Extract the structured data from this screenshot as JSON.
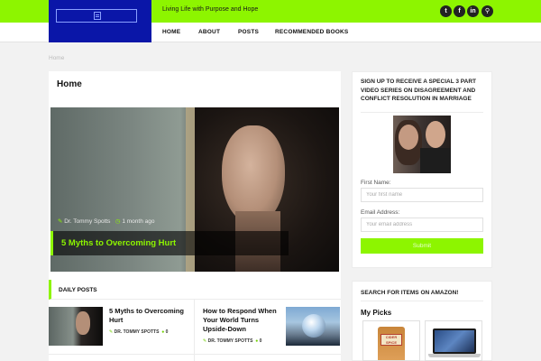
{
  "header": {
    "tagline": "Living Life with Purpose and Hope",
    "social": [
      {
        "icon": "twitter-icon",
        "glyph": "t"
      },
      {
        "icon": "facebook-icon",
        "glyph": "f"
      },
      {
        "icon": "linkedin-icon",
        "glyph": "in"
      },
      {
        "icon": "search-icon",
        "glyph": "⚲"
      }
    ],
    "colors": {
      "accent": "#8df500",
      "logo_bg": "#0a16a8"
    }
  },
  "nav": {
    "items": [
      "HOME",
      "ABOUT",
      "POSTS",
      "RECOMMENDED BOOKS"
    ]
  },
  "breadcrumb": "Home",
  "main": {
    "title": "Home",
    "featured": {
      "author": "Dr. Tommy Spotts",
      "time": "1 month ago",
      "title": "5 Myths to Overcoming Hurt"
    },
    "daily_posts": {
      "heading": "DAILY POSTS",
      "posts": [
        {
          "title_line1": "5 Myths to Overcoming",
          "title_line2": "Hurt",
          "author": "DR. TOMMY SPOTTS",
          "comments": "0"
        },
        {
          "title_line1": "How to Respond When",
          "title_line2": "Your World Turns",
          "title_line3": "Upside-Down",
          "author": "DR. TOMMY SPOTTS",
          "comments": "0"
        }
      ]
    }
  },
  "sidebar": {
    "signup": {
      "text": "SIGN UP TO RECEIVE A SPECIAL 3 PART VIDEO SERIES ON DISAGREEMENT AND CONFLICT RESOLUTION IN MARRIAGE",
      "first_name_label": "First Name:",
      "first_name_placeholder": "Your first name",
      "email_label": "Email Address:",
      "email_placeholder": "Your email address",
      "submit_label": "Submit"
    },
    "amazon": {
      "heading": "SEARCH FOR ITEMS ON AMAZON!",
      "picks_title": "My Picks",
      "products": [
        {
          "label": "CIDER SPICE"
        }
      ]
    }
  }
}
